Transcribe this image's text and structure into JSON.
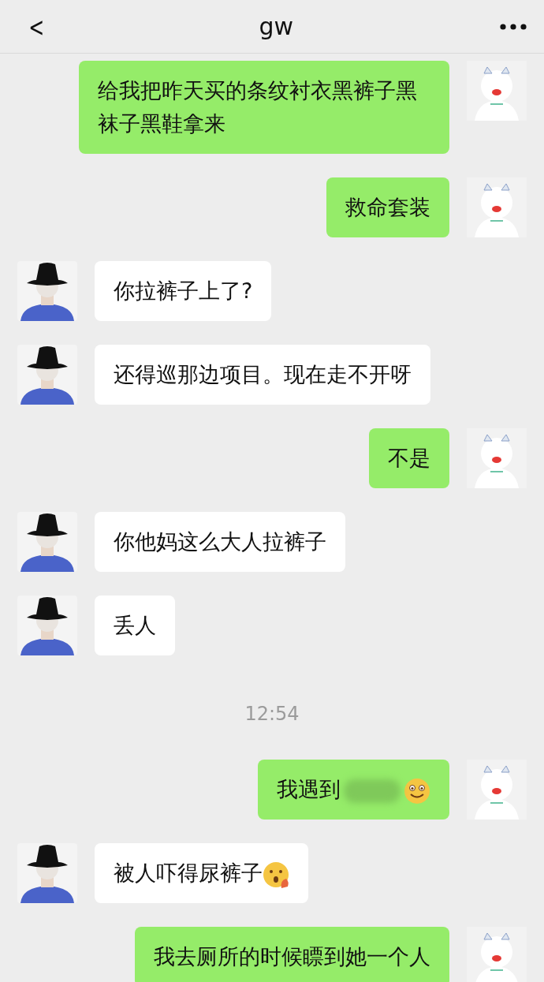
{
  "header": {
    "back": "<",
    "title": "gw"
  },
  "messages": [
    {
      "kind": "sent",
      "text": "给我把昨天买的条纹衬衣黑裤子黑袜子黑鞋拿来"
    },
    {
      "kind": "sent",
      "text": "救命套装"
    },
    {
      "kind": "received",
      "text": "你拉裤子上了?"
    },
    {
      "kind": "received",
      "text": "还得巡那边项目。现在走不开呀"
    },
    {
      "kind": "sent",
      "text": "不是"
    },
    {
      "kind": "received",
      "text": "你他妈这么大人拉裤子"
    },
    {
      "kind": "received",
      "text": "丢人"
    },
    {
      "kind": "time",
      "text": "12:54"
    },
    {
      "kind": "sent",
      "text": "我遇到",
      "redacted": true,
      "emoji": {
        "kind": "smile"
      }
    },
    {
      "kind": "received",
      "text": "被人吓得尿裤子",
      "emoji": {
        "kind": "surprised"
      }
    },
    {
      "kind": "sent",
      "text": "我去厕所的时候瞟到她一个人"
    }
  ]
}
